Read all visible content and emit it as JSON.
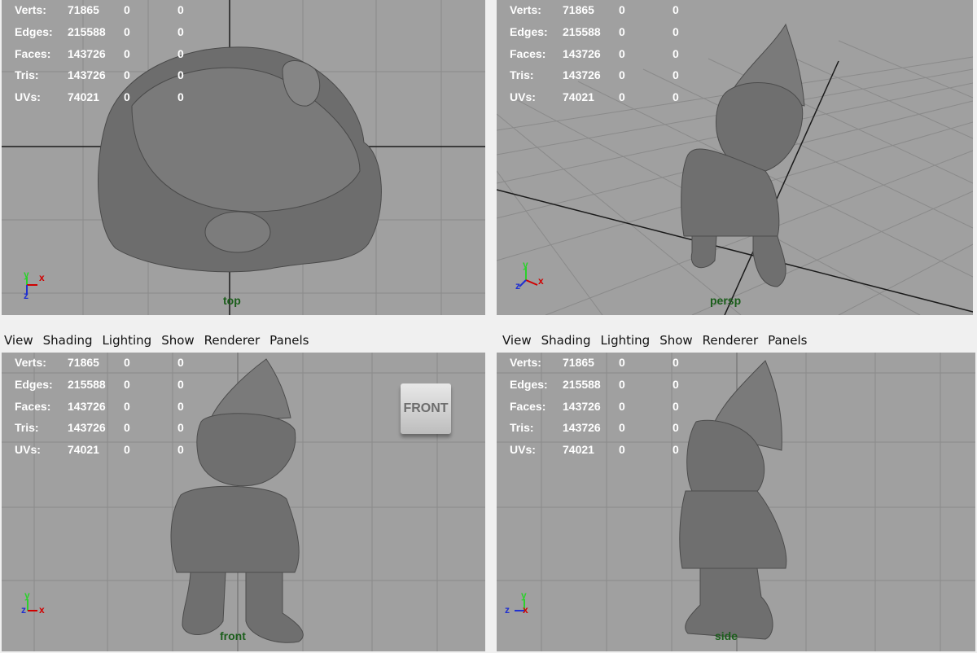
{
  "menu": [
    "View",
    "Shading",
    "Lighting",
    "Show",
    "Renderer",
    "Panels"
  ],
  "stats": [
    {
      "label": "Verts:",
      "v1": "71865",
      "v2": "0",
      "v3": "0"
    },
    {
      "label": "Edges:",
      "v1": "215588",
      "v2": "0",
      "v3": "0"
    },
    {
      "label": "Faces:",
      "v1": "143726",
      "v2": "0",
      "v3": "0"
    },
    {
      "label": "Tris:",
      "v1": "143726",
      "v2": "0",
      "v3": "0"
    },
    {
      "label": "UVs:",
      "v1": "74021",
      "v2": "0",
      "v3": "0"
    }
  ],
  "cameras": {
    "top": "top",
    "persp": "persp",
    "front": "front",
    "side": "side"
  },
  "view_cube": "FRONT",
  "axes": {
    "x": "x",
    "y": "y",
    "z": "z"
  },
  "colors": {
    "viewport_bg": "#a0a0a0",
    "grid": "#8a8a8a",
    "axis_line": "#1a1a1a",
    "model": "#6f6f6f",
    "stats_text": "#ffffff",
    "camera_label": "#1b5e1b",
    "axis_x": "#d00000",
    "axis_y": "#2bd12b",
    "axis_z": "#2030d0"
  },
  "icons": {
    "axis_gizmo": "axis-gizmo-icon",
    "view_cube": "view-cube-icon"
  }
}
